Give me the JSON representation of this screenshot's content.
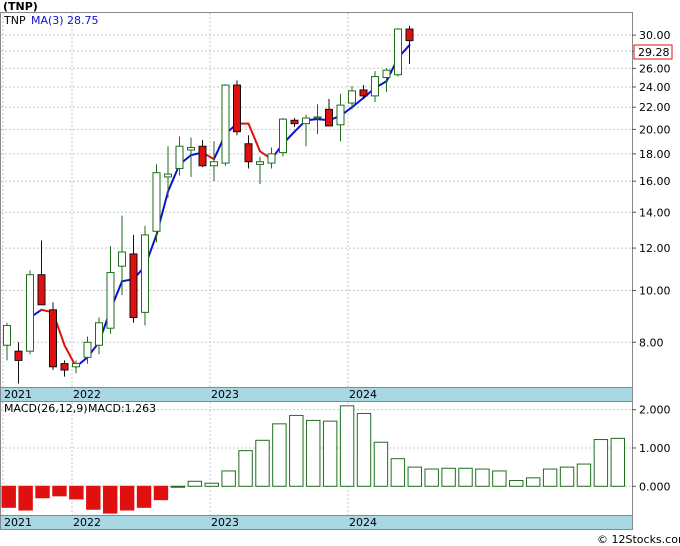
{
  "title": "(TNP)",
  "watermark": "© 12Stocks.com",
  "colors": {
    "up": "#1e6e1e",
    "down_fill": "#e01010",
    "ma_up": "#1010d0",
    "ma_down": "#e01010",
    "macd_bar": "#1e6e1e",
    "macd_neg": "#e01010",
    "axis_band": "#a9d8e4",
    "grid": "#c8c8c8"
  },
  "chart_data": [
    {
      "type": "candlestick",
      "scale": "log",
      "ylim": [
        6.6,
        33
      ],
      "yticks": [
        "30.00",
        "28.00",
        "26.00",
        "24.00",
        "22.00",
        "20.00",
        "18.00",
        "16.00",
        "14.00",
        "12.00",
        "10.00",
        "8.00"
      ],
      "xticks": [
        "2021",
        "2022",
        "2023",
        "2024"
      ],
      "legend": {
        "symbol": "TNP",
        "ma_label": "MA(3)",
        "ma_value": "28.75"
      },
      "last_price": "29.28",
      "grid": true,
      "candles": [
        {
          "o": 7.9,
          "h": 8.7,
          "l": 7.4,
          "c": 8.6
        },
        {
          "o": 7.7,
          "h": 8.0,
          "l": 6.7,
          "c": 7.4
        },
        {
          "o": 7.7,
          "h": 10.9,
          "l": 7.6,
          "c": 10.7
        },
        {
          "o": 10.7,
          "h": 12.4,
          "l": 9.4,
          "c": 9.4
        },
        {
          "o": 9.2,
          "h": 9.5,
          "l": 7.1,
          "c": 7.2
        },
        {
          "o": 7.3,
          "h": 7.4,
          "l": 6.9,
          "c": 7.1
        },
        {
          "o": 7.2,
          "h": 7.4,
          "l": 7.0,
          "c": 7.3
        },
        {
          "o": 7.5,
          "h": 8.2,
          "l": 7.3,
          "c": 8.0
        },
        {
          "o": 7.9,
          "h": 8.9,
          "l": 7.6,
          "c": 8.7
        },
        {
          "o": 8.5,
          "h": 12.1,
          "l": 8.3,
          "c": 10.8
        },
        {
          "o": 11.1,
          "h": 13.8,
          "l": 9.8,
          "c": 11.8
        },
        {
          "o": 11.7,
          "h": 12.7,
          "l": 8.7,
          "c": 8.9
        },
        {
          "o": 9.1,
          "h": 13.2,
          "l": 8.6,
          "c": 12.7
        },
        {
          "o": 12.9,
          "h": 17.2,
          "l": 12.3,
          "c": 16.6
        },
        {
          "o": 16.3,
          "h": 18.6,
          "l": 14.9,
          "c": 16.5
        },
        {
          "o": 16.9,
          "h": 19.4,
          "l": 16.4,
          "c": 18.6
        },
        {
          "o": 18.3,
          "h": 19.3,
          "l": 16.3,
          "c": 18.5
        },
        {
          "o": 18.6,
          "h": 19.1,
          "l": 17.0,
          "c": 17.1
        },
        {
          "o": 17.1,
          "h": 19.0,
          "l": 16.0,
          "c": 17.4
        },
        {
          "o": 17.3,
          "h": 24.3,
          "l": 17.1,
          "c": 24.2
        },
        {
          "o": 24.2,
          "h": 24.7,
          "l": 19.5,
          "c": 19.8
        },
        {
          "o": 18.8,
          "h": 19.5,
          "l": 16.9,
          "c": 17.4
        },
        {
          "o": 17.2,
          "h": 17.8,
          "l": 15.8,
          "c": 17.4
        },
        {
          "o": 17.3,
          "h": 18.5,
          "l": 16.9,
          "c": 18.0
        },
        {
          "o": 18.1,
          "h": 21.0,
          "l": 17.8,
          "c": 20.9
        },
        {
          "o": 20.8,
          "h": 21.0,
          "l": 20.2,
          "c": 20.5
        },
        {
          "o": 20.5,
          "h": 21.3,
          "l": 18.6,
          "c": 21.0
        },
        {
          "o": 21.0,
          "h": 22.3,
          "l": 19.6,
          "c": 21.1
        },
        {
          "o": 21.8,
          "h": 22.8,
          "l": 20.3,
          "c": 20.3
        },
        {
          "o": 20.4,
          "h": 23.3,
          "l": 19.0,
          "c": 22.2
        },
        {
          "o": 22.4,
          "h": 24.1,
          "l": 21.8,
          "c": 23.6
        },
        {
          "o": 23.7,
          "h": 24.2,
          "l": 22.8,
          "c": 23.1
        },
        {
          "o": 23.1,
          "h": 25.7,
          "l": 22.5,
          "c": 25.1
        },
        {
          "o": 25.0,
          "h": 26.0,
          "l": 23.5,
          "c": 25.8
        },
        {
          "o": 25.3,
          "h": 30.9,
          "l": 25.1,
          "c": 30.8
        },
        {
          "o": 30.8,
          "h": 31.2,
          "l": 26.5,
          "c": 29.3
        }
      ],
      "ma": [
        null,
        null,
        8.9,
        9.2,
        9.1,
        7.9,
        7.2,
        7.5,
        8.0,
        9.2,
        10.4,
        10.5,
        11.1,
        12.7,
        15.3,
        17.2,
        17.9,
        18.1,
        17.6,
        19.6,
        20.5,
        20.5,
        18.2,
        17.6,
        18.8,
        19.8,
        20.8,
        20.9,
        20.8,
        21.2,
        22.0,
        22.9,
        23.9,
        24.6,
        27.2,
        28.75
      ],
      "ma_dir": [
        null,
        null,
        "up",
        "up",
        "down",
        "down",
        "down",
        "up",
        "up",
        "up",
        "up",
        "up",
        "up",
        "up",
        "up",
        "up",
        "up",
        "up",
        "down",
        "up",
        "up",
        "down",
        "down",
        "down",
        "up",
        "up",
        "up",
        "up",
        "up",
        "up",
        "up",
        "up",
        "up",
        "up",
        "up",
        "up"
      ]
    },
    {
      "type": "bar",
      "name_label": "MACD(26,12,9)",
      "value_label": "MACD:1.263",
      "ylim": [
        -0.75,
        2.2
      ],
      "yticks": [
        "2.000",
        "1.000",
        "0.000"
      ],
      "xticks": [
        "2021",
        "2022",
        "2023",
        "2024"
      ],
      "values": [
        -0.55,
        -0.62,
        -0.3,
        -0.25,
        -0.33,
        -0.6,
        -0.7,
        -0.62,
        -0.55,
        -0.35,
        0.0,
        0.13,
        0.08,
        0.4,
        0.93,
        1.2,
        1.63,
        1.85,
        1.72,
        1.7,
        2.1,
        1.9,
        1.15,
        0.72,
        0.5,
        0.45,
        0.47,
        0.47,
        0.45,
        0.4,
        0.15,
        0.22,
        0.45,
        0.5,
        0.58,
        1.22,
        1.25
      ]
    }
  ]
}
